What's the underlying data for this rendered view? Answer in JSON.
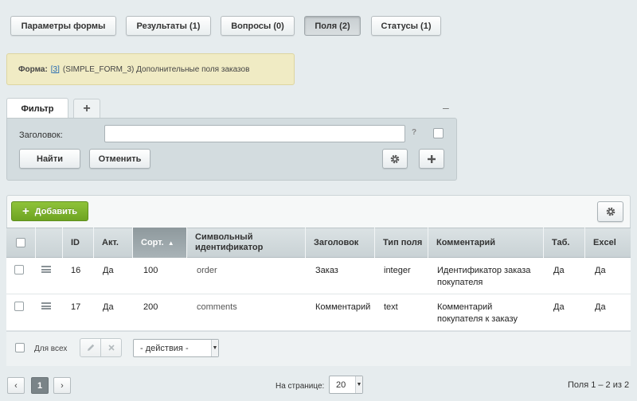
{
  "tabs": [
    {
      "label": "Параметры формы"
    },
    {
      "label": "Результаты (1)"
    },
    {
      "label": "Вопросы (0)"
    },
    {
      "label": "Поля (2)"
    },
    {
      "label": "Статусы (1)"
    }
  ],
  "notice": {
    "label": "Форма:",
    "link": "[3]",
    "text": "(SIMPLE_FORM_3) Дополнительные поля заказов"
  },
  "filter": {
    "tab_label": "Фильтр",
    "add_tab": "+",
    "collapse": "–",
    "field_label": "Заголовок:",
    "field_value": "",
    "help": "?",
    "find_label": "Найти",
    "cancel_label": "Отменить"
  },
  "grid": {
    "add_label": "Добавить",
    "columns": [
      "ID",
      "Акт.",
      "Сорт.",
      "Символьный идентификатор",
      "Заголовок",
      "Тип поля",
      "Комментарий",
      "Таб.",
      "Excel"
    ],
    "sort_arrow": "▲",
    "rows": [
      {
        "id": "16",
        "active": "Да",
        "sort": "100",
        "code": "order",
        "title": "Заказ",
        "type": "integer",
        "comment": "Идентификатор заказа покупателя",
        "tab": "Да",
        "excel": "Да"
      },
      {
        "id": "17",
        "active": "Да",
        "sort": "200",
        "code": "comments",
        "title": "Комментарий",
        "type": "text",
        "comment": "Комментарий покупателя к заказу",
        "tab": "Да",
        "excel": "Да"
      }
    ],
    "for_all_label": "Для всех",
    "actions_select": "- действия -"
  },
  "pager": {
    "prev": "‹",
    "current_page": "1",
    "next": "›",
    "per_page_label": "На странице:",
    "per_page_value": "20",
    "summary": "Поля 1 – 2 из 2"
  },
  "icons": {
    "settings": "gear-icon",
    "add": "plus-icon",
    "edit": "pencil-icon",
    "delete": "close-icon",
    "drag": "hamburger-icon"
  }
}
